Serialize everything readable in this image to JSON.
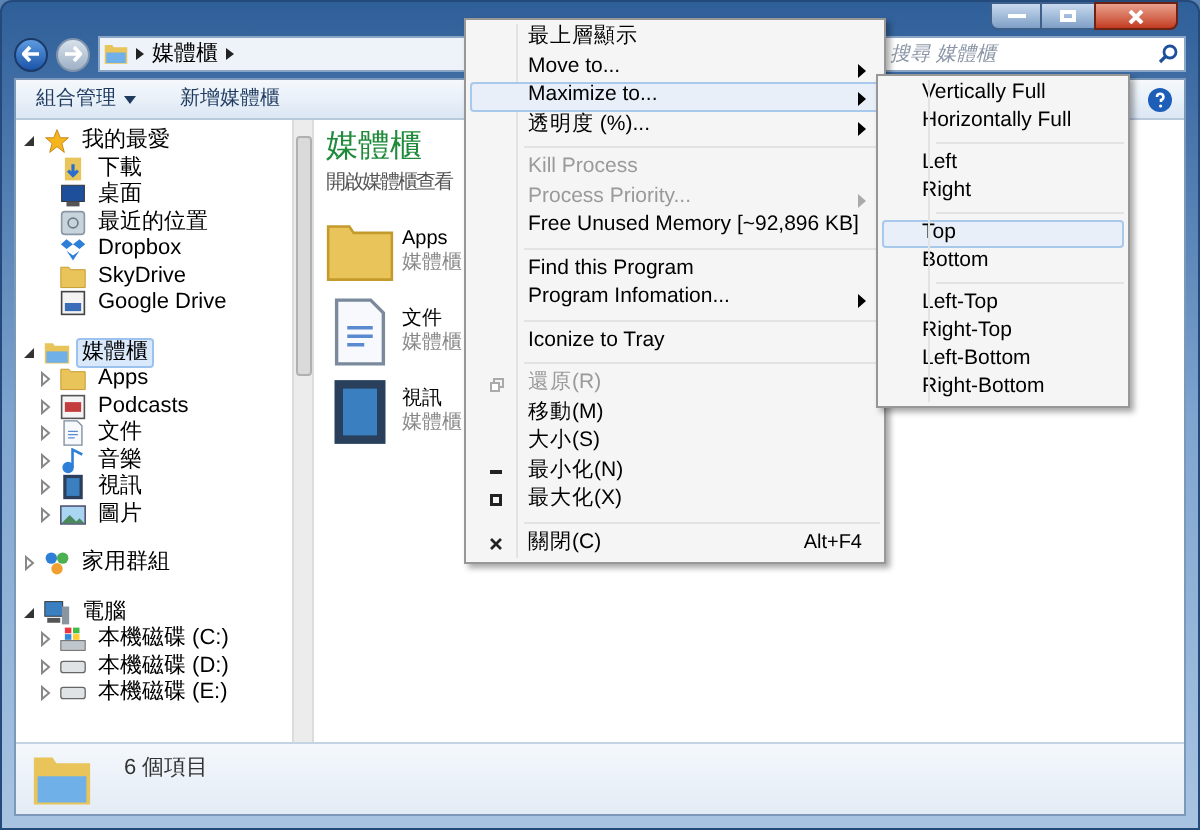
{
  "window": {
    "address_path": [
      "媒體櫃"
    ],
    "search": {
      "placeholder": "搜尋 媒體櫃"
    }
  },
  "toolbar": [
    {
      "label": "組合管理",
      "dropdown": true
    },
    {
      "label": "新增媒體櫃",
      "dropdown": false
    }
  ],
  "sidebar": {
    "groups": [
      {
        "label": "我的最愛",
        "kind": "star",
        "expanded": true,
        "selected": false,
        "children": [
          {
            "label": "下載",
            "kind": "download",
            "selected": false
          },
          {
            "label": "桌面",
            "kind": "desktop",
            "selected": false
          },
          {
            "label": "最近的位置",
            "kind": "recent",
            "selected": false
          },
          {
            "label": "Dropbox",
            "kind": "dropbox",
            "selected": false
          },
          {
            "label": "SkyDrive",
            "kind": "folder",
            "selected": false
          },
          {
            "label": "Google Drive",
            "kind": "drive",
            "selected": false
          }
        ]
      },
      {
        "label": "媒體櫃",
        "kind": "library",
        "expanded": true,
        "selected": true,
        "children": [
          {
            "label": "Apps",
            "kind": "folder",
            "expanded": false,
            "selected": false
          },
          {
            "label": "Podcasts",
            "kind": "podcast",
            "expanded": false,
            "selected": false
          },
          {
            "label": "文件",
            "kind": "document",
            "expanded": false,
            "selected": false
          },
          {
            "label": "音樂",
            "kind": "music",
            "expanded": false,
            "selected": false
          },
          {
            "label": "視訊",
            "kind": "video",
            "expanded": false,
            "selected": false
          },
          {
            "label": "圖片",
            "kind": "picture",
            "expanded": false,
            "selected": false
          }
        ]
      },
      {
        "label": "家用群組",
        "kind": "homegroup",
        "expanded": false,
        "selected": false
      },
      {
        "label": "電腦",
        "kind": "computer",
        "expanded": true,
        "selected": false,
        "children": [
          {
            "label": "本機磁碟 (C:)",
            "kind": "system_drive",
            "expanded": false,
            "selected": false
          },
          {
            "label": "本機磁碟 (D:)",
            "kind": "disk",
            "expanded": false,
            "selected": false
          },
          {
            "label": "本機磁碟 (E:)",
            "kind": "disk",
            "expanded": false,
            "selected": false
          }
        ]
      }
    ]
  },
  "content": {
    "title": "媒體櫃",
    "subtitle": "開啟媒體櫃查看",
    "items": [
      {
        "name": "Apps",
        "type": "媒體櫃",
        "kind": "folder"
      },
      {
        "name": "文件",
        "type": "媒體櫃",
        "kind": "document"
      },
      {
        "name": "視訊",
        "type": "媒體櫃",
        "kind": "video"
      }
    ]
  },
  "status_bar": {
    "text": "6 個項目"
  },
  "context_menu": {
    "groups": [
      [
        {
          "label": "最上層顯示",
          "kind": "plain",
          "submenu": false,
          "disabled": false,
          "selected": false
        },
        {
          "label": "Move to...",
          "kind": "plain",
          "submenu": true,
          "disabled": false,
          "selected": false
        },
        {
          "label": "Maximize to...",
          "kind": "plain",
          "submenu": true,
          "disabled": false,
          "selected": true
        },
        {
          "label": "透明度 (%)...",
          "kind": "plain",
          "submenu": true,
          "disabled": false,
          "selected": false
        }
      ],
      [
        {
          "label": "Kill Process",
          "kind": "plain",
          "submenu": false,
          "disabled": true,
          "selected": false
        },
        {
          "label": "Process Priority...",
          "kind": "plain",
          "submenu": true,
          "disabled": true,
          "selected": false
        },
        {
          "label": "Free Unused Memory [~92,896 KB]",
          "kind": "plain",
          "submenu": false,
          "disabled": false,
          "selected": false
        }
      ],
      [
        {
          "label": "Find this Program",
          "kind": "plain",
          "submenu": false,
          "disabled": false,
          "selected": false
        },
        {
          "label": "Program Infomation...",
          "kind": "plain",
          "submenu": true,
          "disabled": false,
          "selected": false
        }
      ],
      [
        {
          "label": "Iconize to Tray",
          "kind": "plain",
          "submenu": false,
          "disabled": false,
          "selected": false
        }
      ],
      [
        {
          "label": "還原(R)",
          "kind": "restore",
          "submenu": false,
          "disabled": true,
          "selected": false
        },
        {
          "label": "移動(M)",
          "kind": "plain",
          "submenu": false,
          "disabled": false,
          "selected": false
        },
        {
          "label": "大小(S)",
          "kind": "plain",
          "submenu": false,
          "disabled": false,
          "selected": false
        },
        {
          "label": "最小化(N)",
          "kind": "minimize",
          "submenu": false,
          "disabled": false,
          "selected": false
        },
        {
          "label": "最大化(X)",
          "kind": "maximize",
          "submenu": false,
          "disabled": false,
          "selected": false
        }
      ],
      [
        {
          "label": "關閉(C)",
          "kind": "close",
          "shortcut": "Alt+F4",
          "submenu": false,
          "disabled": false,
          "selected": false
        }
      ]
    ]
  },
  "submenu": {
    "groups": [
      [
        {
          "label": "Vertically Full",
          "selected": false
        },
        {
          "label": "Horizontally Full",
          "selected": false
        }
      ],
      [
        {
          "label": "Left",
          "selected": false
        },
        {
          "label": "Right",
          "selected": false
        }
      ],
      [
        {
          "label": "Top",
          "selected": true
        },
        {
          "label": "Bottom",
          "selected": false
        }
      ],
      [
        {
          "label": "Left-Top",
          "selected": false
        },
        {
          "label": "Right-Top",
          "selected": false
        },
        {
          "label": "Left-Bottom",
          "selected": false
        },
        {
          "label": "Right-Bottom",
          "selected": false
        }
      ]
    ]
  }
}
